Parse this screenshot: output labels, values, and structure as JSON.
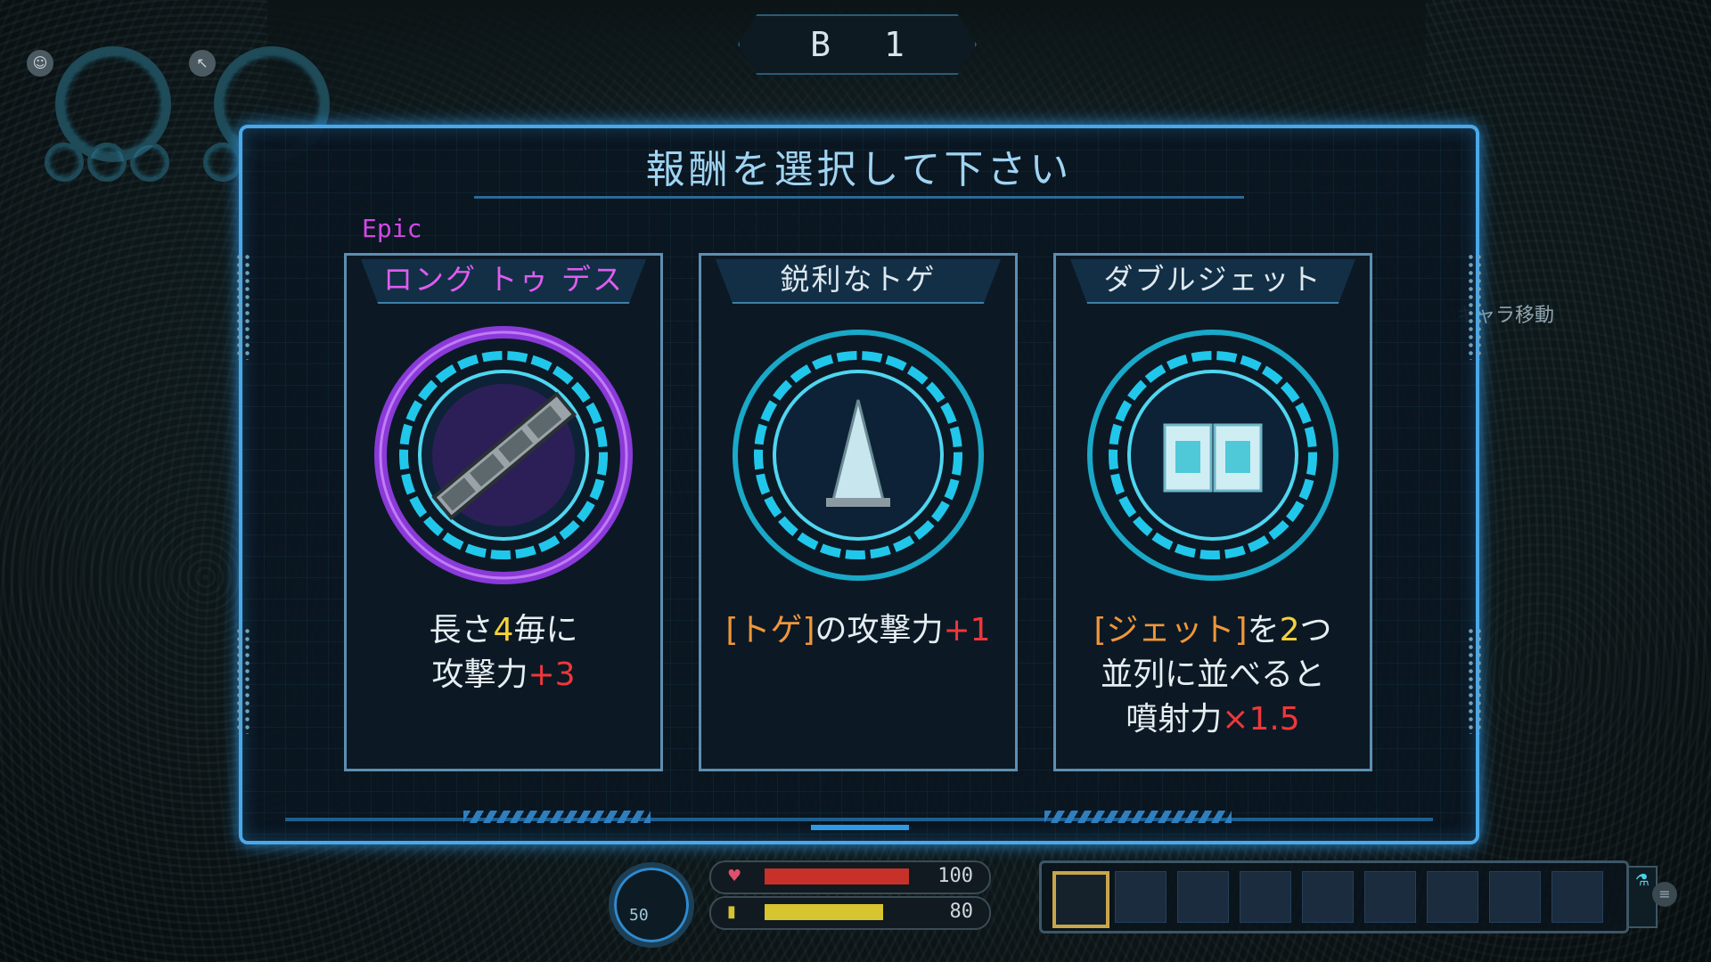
{
  "floor": {
    "label": "B",
    "number": "1"
  },
  "dialog": {
    "title": "報酬を選択して下さい",
    "rarity_label": "Epic",
    "cards": [
      {
        "name": "ロング トゥ デス",
        "rarity": "epic",
        "icon": "chain-icon",
        "desc_line1_a": "長さ",
        "desc_line1_b": "4",
        "desc_line1_c": "毎に",
        "desc_line2_a": "攻撃力",
        "desc_line2_b": "+3"
      },
      {
        "name": "鋭利なトゲ",
        "rarity": "common",
        "icon": "spike-icon",
        "desc_line1_a": "[トゲ]",
        "desc_line1_b": "の攻撃力",
        "desc_line1_c": "+1"
      },
      {
        "name": "ダブルジェット",
        "rarity": "common",
        "icon": "twin-jet-icon",
        "desc_line1_a": "[ジェット]",
        "desc_line1_b": "を",
        "desc_line1_c": "2",
        "desc_line1_d": "つ",
        "desc_line2_a": "並列に並べると",
        "desc_line3_a": "噴射力",
        "desc_line3_b": "×1.5"
      }
    ]
  },
  "side_hint": "キャラ移動",
  "hud": {
    "gauge_value": "50",
    "health": {
      "value": "100",
      "fraction": 0.95,
      "color": "#c8302a"
    },
    "energy": {
      "value": "80",
      "fraction": 0.78,
      "color": "#d6c430"
    },
    "hotbar_slot_count": 9,
    "selected_slot": 0
  },
  "colors": {
    "accent": "#4aa8e8",
    "epic": "#d348e8"
  }
}
